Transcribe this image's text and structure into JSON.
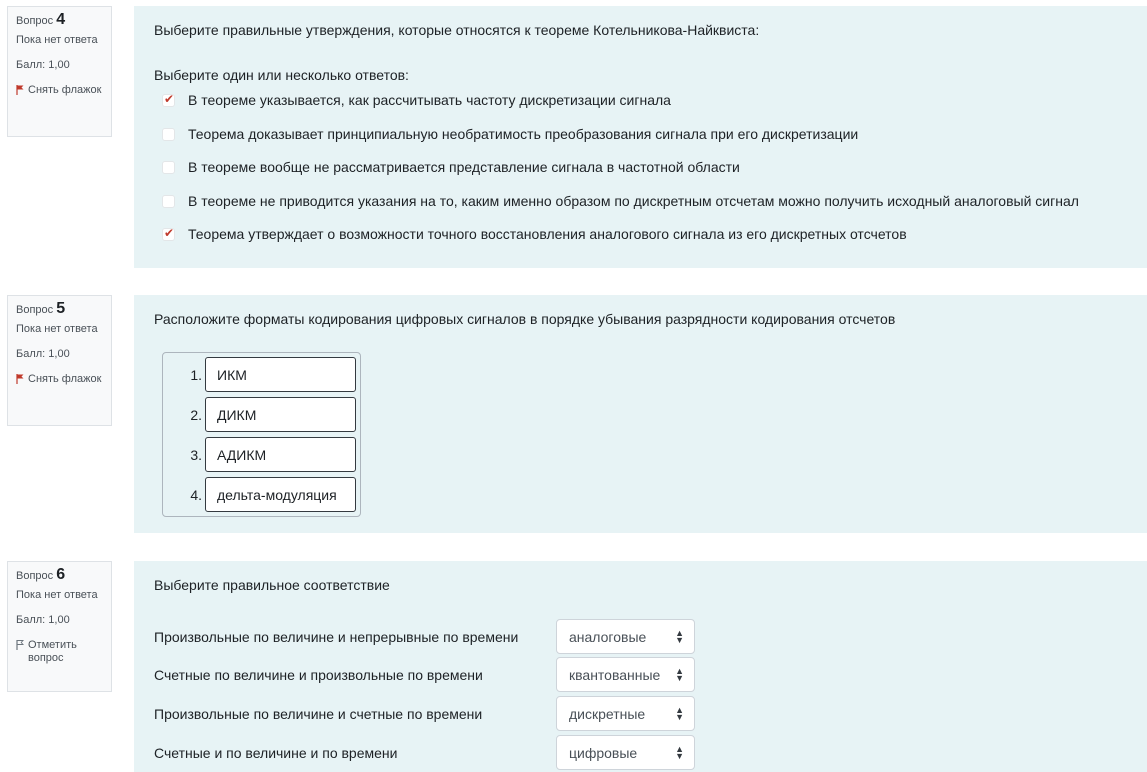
{
  "q4": {
    "label": "Вопрос",
    "number": "4",
    "status": "Пока нет ответа",
    "grade": "Балл: 1,00",
    "flag": "Снять флажок",
    "text": "Выберите правильные утверждения, которые относятся к теореме Котельникова-Найквиста:",
    "prompt": "Выберите один или несколько ответов:",
    "options": [
      {
        "label": "В теореме указывается, как рассчитывать частоту дискретизации сигнала",
        "checked": true
      },
      {
        "label": "Теорема доказывает принципиальную необратимость преобразования сигнала при его дискретизации",
        "checked": false
      },
      {
        "label": "В теореме вообще не рассматривается представление сигнала в частотной области",
        "checked": false
      },
      {
        "label": "В теореме не приводится указания на то, каким именно образом по дискретным отсчетам можно получить исходный аналоговый сигнал",
        "checked": false
      },
      {
        "label": "Теорема утверждает о возможности точного восстановления аналогового сигнала из его дискретных отсчетов",
        "checked": true
      }
    ]
  },
  "q5": {
    "label": "Вопрос",
    "number": "5",
    "status": "Пока нет ответа",
    "grade": "Балл: 1,00",
    "flag": "Снять флажок",
    "text": "Расположите форматы кодирования цифровых сигналов в порядке убывания разрядности кодирования отсчетов",
    "items": [
      {
        "num": "1.",
        "label": "ИКМ"
      },
      {
        "num": "2.",
        "label": "ДИКМ"
      },
      {
        "num": "3.",
        "label": "АДИКМ"
      },
      {
        "num": "4.",
        "label": "дельта-модуляция"
      }
    ]
  },
  "q6": {
    "label": "Вопрос",
    "number": "6",
    "status": "Пока нет ответа",
    "grade": "Балл: 1,00",
    "flag": "Отметить вопрос",
    "text": "Выберите правильное соответствие",
    "rows": [
      {
        "label": "Произвольные по величине и непрерывные по времени",
        "value": "аналоговые"
      },
      {
        "label": "Счетные по величине и произвольные по времени",
        "value": "квантованные"
      },
      {
        "label": "Произвольные по величине и счетные по времени",
        "value": "дискретные"
      },
      {
        "label": "Счетные и по величине и по времени",
        "value": "цифровые"
      }
    ]
  },
  "colors": {
    "content_bg": "#e7f3f5",
    "flag_red": "#c0392b",
    "check_red": "#c0392b"
  },
  "icons": {
    "flag_set": "red-flag-icon",
    "flag_unset": "outline-flag-icon",
    "check": "checkmark-icon",
    "select_arrows": "updown-caret-icon"
  }
}
